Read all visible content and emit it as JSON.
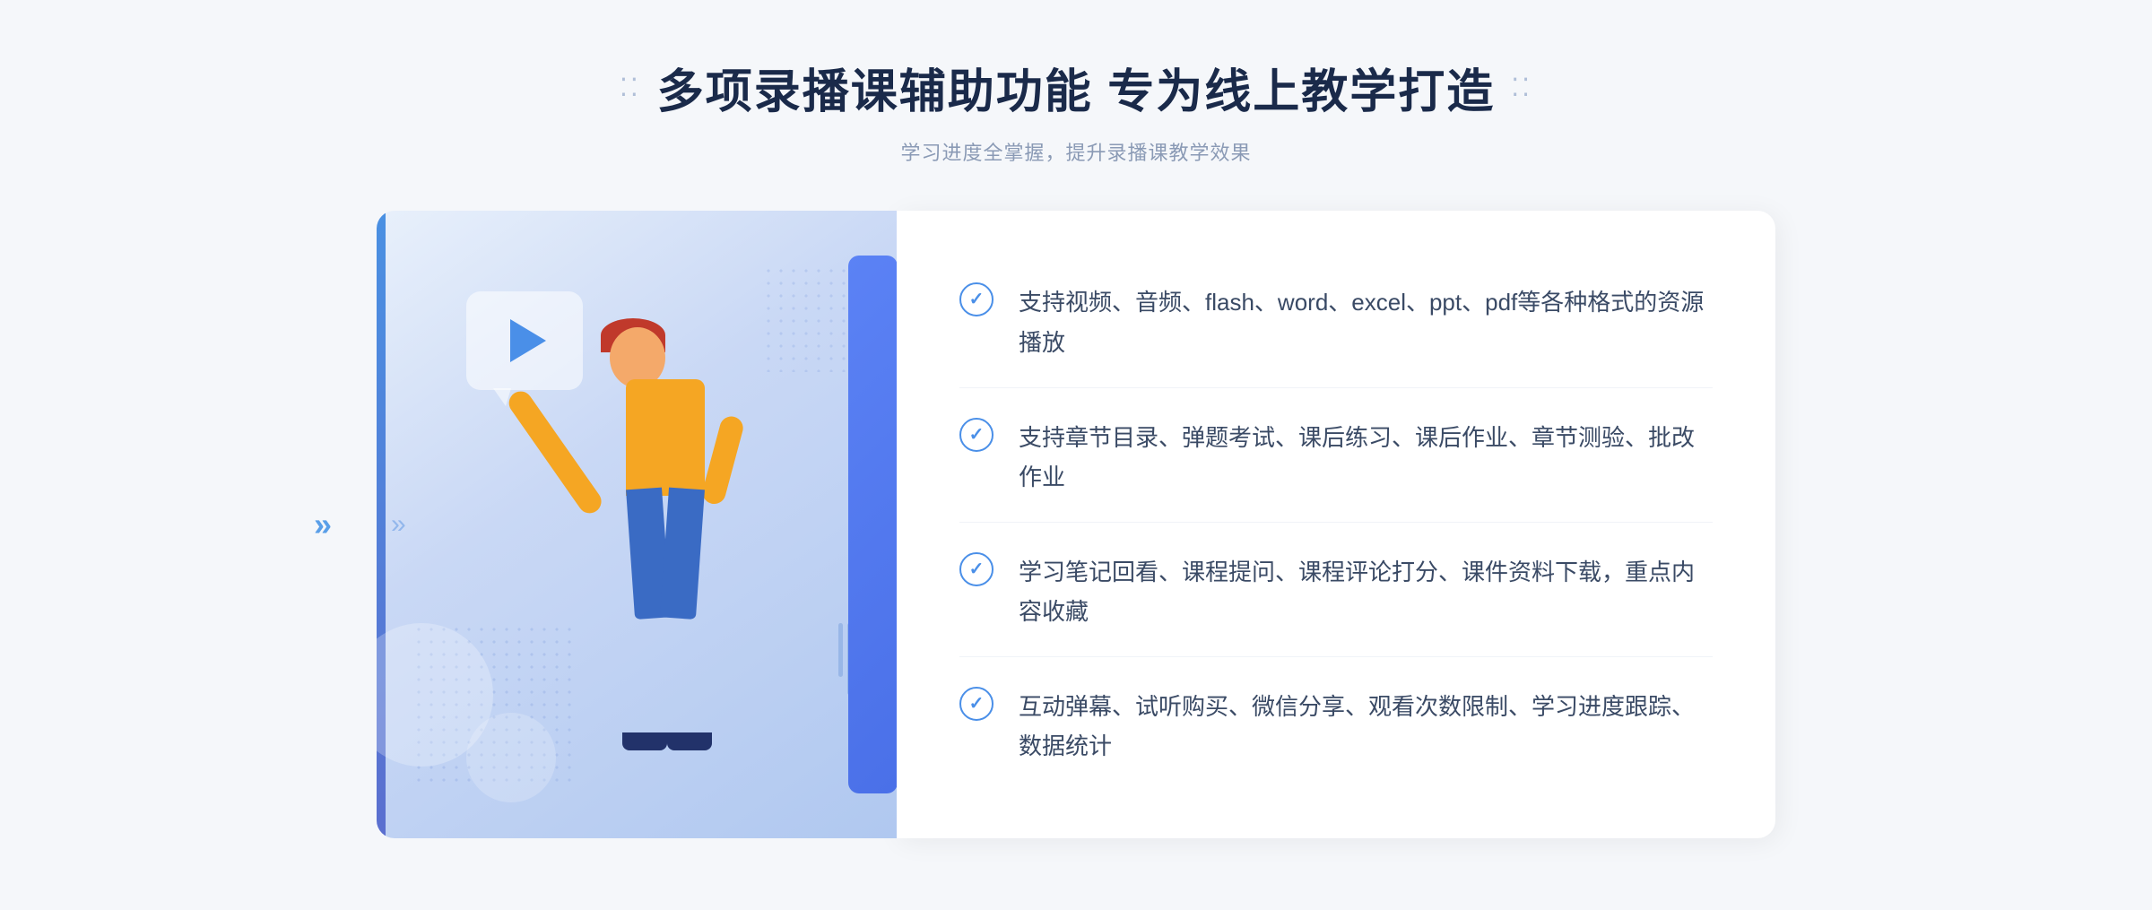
{
  "header": {
    "dots_left": "⁚⁚",
    "dots_right": "⁚⁚",
    "title": "多项录播课辅助功能 专为线上教学打造",
    "subtitle": "学习进度全掌握，提升录播课教学效果"
  },
  "features": [
    {
      "id": "feature-1",
      "text": "支持视频、音频、flash、word、excel、ppt、pdf等各种格式的资源播放"
    },
    {
      "id": "feature-2",
      "text": "支持章节目录、弹题考试、课后练习、课后作业、章节测验、批改作业"
    },
    {
      "id": "feature-3",
      "text": "学习笔记回看、课程提问、课程评论打分、课件资料下载，重点内容收藏"
    },
    {
      "id": "feature-4",
      "text": "互动弹幕、试听购买、微信分享、观看次数限制、学习进度跟踪、数据统计"
    }
  ],
  "icons": {
    "check": "✓",
    "play": "▶",
    "chevron_left": "»",
    "page_arrow": "»"
  },
  "colors": {
    "primary_blue": "#4a8fe8",
    "dark_blue": "#3a6bc4",
    "title_color": "#1a2a4a",
    "text_color": "#3a4a65",
    "subtitle_color": "#8a9ab5",
    "bg": "#f5f7fa",
    "white": "#ffffff"
  }
}
